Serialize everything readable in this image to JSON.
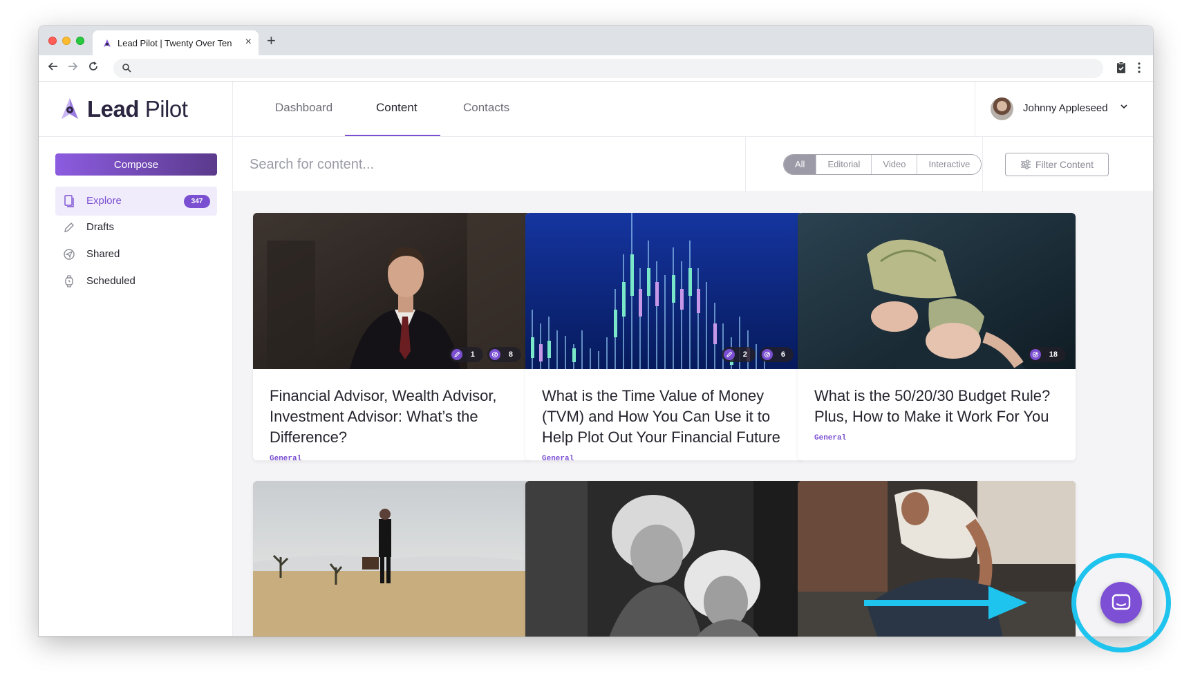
{
  "browser": {
    "tab_title": "Lead Pilot | Twenty Over Ten",
    "new_tab_label": "+",
    "close_label": "×",
    "address": ""
  },
  "app": {
    "logo_bold": "Lead",
    "logo_light": "Pilot",
    "nav": [
      {
        "label": "Dashboard"
      },
      {
        "label": "Content",
        "active": true
      },
      {
        "label": "Contacts"
      }
    ],
    "user_name": "Johnny Appleseed"
  },
  "sidebar": {
    "compose_label": "Compose",
    "items": [
      {
        "label": "Explore",
        "icon": "explore-icon",
        "badge": "347",
        "active": true
      },
      {
        "label": "Drafts",
        "icon": "pencil-icon"
      },
      {
        "label": "Shared",
        "icon": "share-icon"
      },
      {
        "label": "Scheduled",
        "icon": "watch-icon"
      }
    ]
  },
  "search": {
    "placeholder": "Search for content...",
    "value": ""
  },
  "filters": {
    "segments": [
      "All",
      "Editorial",
      "Video",
      "Interactive"
    ],
    "selected": "All",
    "filter_button_label": "Filter Content"
  },
  "cards": [
    {
      "title": "Financial Advisor, Wealth Advisor, Investment Advisor: What’s the Difference?",
      "tag": "General",
      "edits": "1",
      "shares": "8"
    },
    {
      "title": "What is the Time Value of Money (TVM) and How You Can Use it to Help Plot Out Your Financial Future",
      "tag": "General",
      "edits": "2",
      "shares": "6"
    },
    {
      "title": "What is the 50/20/30 Budget Rule? Plus, How to Make it Work For You",
      "tag": "General",
      "shares": "18"
    }
  ],
  "colors": {
    "accent": "#7a4fd1",
    "annotation": "#1ec3ee",
    "chat_button": "#7c4fd4"
  }
}
